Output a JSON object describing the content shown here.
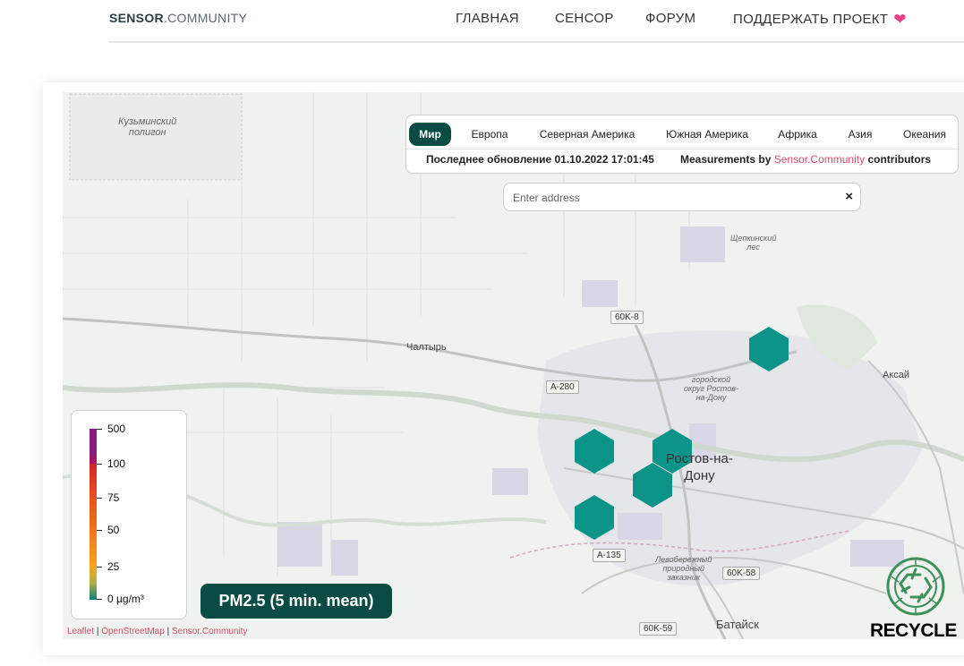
{
  "header": {
    "logo_bold": "SENSOR",
    "logo_light": ".COMMUNITY",
    "nav": [
      "ГЛАВНАЯ",
      "СЕНСОР",
      "ФОРУМ",
      "ПОДДЕРЖАТЬ ПРОЕКТ"
    ],
    "support_icon": "heart-icon",
    "heart_color": "#e83e8c"
  },
  "regions": {
    "tabs": [
      "Мир",
      "Европа",
      "Северная Америка",
      "Южная Америка",
      "Африка",
      "Азия",
      "Океания"
    ],
    "active": "Мир",
    "active_color": "#0a4b44",
    "last_update": "Последнее обновление 01.10.2022 17:01:45",
    "measurements_prefix": "Measurements by",
    "measurements_link": "Sensor.Community",
    "measurements_suffix": "contributors"
  },
  "search": {
    "placeholder": "Enter address",
    "clear_symbol": "×"
  },
  "legend": {
    "labels": [
      "500",
      "100",
      "75",
      "50",
      "25",
      "0 µg/m³"
    ]
  },
  "pm_badge": "PM2.5 (5 min. mean)",
  "attribution": {
    "items": [
      "Leaflet",
      "OpenStreetMap",
      "Sensor.Community"
    ],
    "separator": "|"
  },
  "recycle": {
    "label": "RECYCLE",
    "icon": "recycle-icon"
  },
  "map": {
    "sensor_color": "#0d9488",
    "labels": {
      "polygon": [
        "Кузьминский",
        "полигон"
      ],
      "chaltyr": "Чалтырь",
      "shchepkin": [
        "Щепкинский",
        "лес"
      ],
      "aksay": "Аксай",
      "city_district": [
        "городской",
        "округ Ростов-",
        "на-Дону"
      ],
      "rostov": [
        "Ростов-на-",
        "Дону"
      ],
      "bataysk": "Батайск",
      "reserve": [
        "Левобережный",
        "природный",
        "заказник"
      ],
      "roads": [
        "60K-8",
        "A-280",
        "A-135",
        "60K-58",
        "60K-59"
      ]
    }
  }
}
